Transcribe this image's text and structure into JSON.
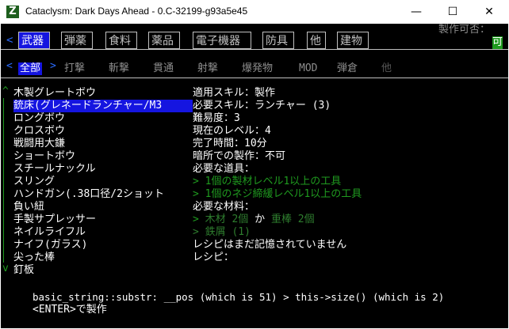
{
  "window": {
    "title": "Cataclysm: Dark Days Ahead - 0.C-32199-g93a5e45",
    "icon_letter": "Z"
  },
  "craft_status": {
    "label": "製作可否：",
    "value": "可"
  },
  "nav": {
    "left_arrow": "<",
    "right_arrow": ">"
  },
  "tabs": [
    "武器",
    "弾薬",
    "食料",
    "薬品",
    "電子機器",
    "防具",
    "他",
    "建物"
  ],
  "subtabs": [
    "全部",
    "打撃",
    "斬撃",
    "貫通",
    "射撃",
    "爆発物",
    "MOD",
    "弾倉",
    "他"
  ],
  "recipes": [
    "木製グレートボウ",
    "銃床(グレネードランチャー/M3",
    "ロングボウ",
    "クロスボウ",
    "戦闘用大鎌",
    "ショートボウ",
    "スチールナックル",
    "スリング",
    "ハンドガン(.38口径/2ショット",
    "負い紐",
    "手製サプレッサー",
    "ネイルライフル",
    "ナイフ(ガラス)",
    "尖った棒",
    "釘板"
  ],
  "details": {
    "skill_used": "適用スキル：製作",
    "skill_required": "必要スキル：ランチャー (3)",
    "difficulty": "難易度：3",
    "current_level": "現在のレベル：4",
    "time": "完了時間：10分",
    "dark_craft": "暗所での製作：不可",
    "tools_header": "必要な道具：",
    "tool_1": "> 1個の製材レベル1以上の工具",
    "tool_2": "> 1個のネジ締緩レベル1以上の工具",
    "materials_header": "必要な材料：",
    "material_prefix": "> ",
    "material_a": "木材 2個",
    "material_or": " か ",
    "material_b": "重棒 2個",
    "material_2": "> 鉄屑 (1)",
    "memorized": "レシピはまだ記憶されていません",
    "recipe_label": "レシピ："
  },
  "error_line": "basic_string::substr: __pos (which is 51) > this->size() (which is 2)",
  "footer": "<ENTER>で製作",
  "scroll_marks": {
    "up": "^",
    "down": "v"
  }
}
